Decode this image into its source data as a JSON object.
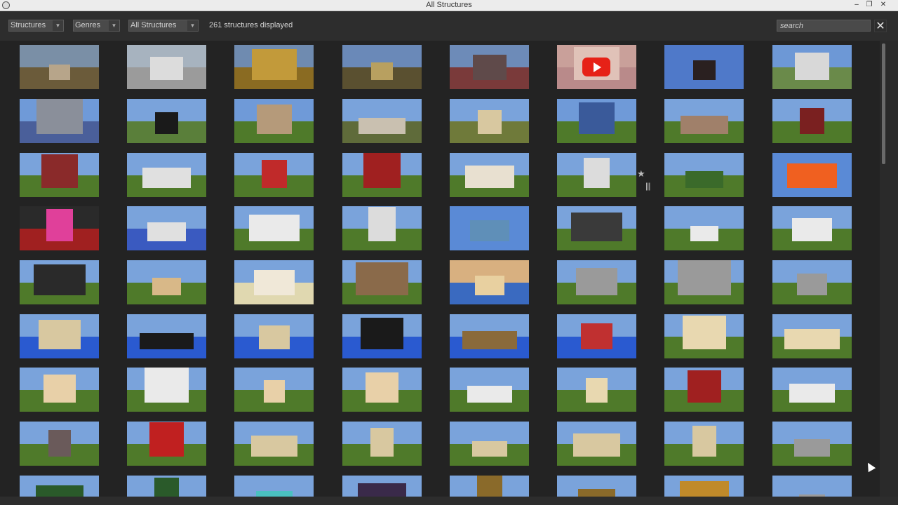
{
  "window": {
    "title": "All Structures"
  },
  "toolbar": {
    "filters": [
      {
        "label": "Structures"
      },
      {
        "label": "Genres"
      },
      {
        "label": "All Structures"
      }
    ],
    "count_text": "261 structures displayed",
    "search_placeholder": "search",
    "close_label": "✕"
  },
  "colors": {
    "accent": "#e62117",
    "background": "#232323",
    "toolbar": "#2d2d2d"
  },
  "icons": [
    "app-icon",
    "minimize-icon",
    "restore-icon",
    "close-icon",
    "chevron-down-icon",
    "youtube-play-icon",
    "star-icon",
    "drag-handle-icon",
    "mouse-cursor-icon"
  ],
  "grid": {
    "columns": 8,
    "thumbnails": [
      {
        "sky": "#7a8fa6",
        "ground": "#6b5b3a",
        "build": "#b7a58a"
      },
      {
        "sky": "#a7b3bf",
        "ground": "#9b9b9b",
        "build": "#dcdcdc"
      },
      {
        "sky": "#6f8bb0",
        "ground": "#8a6b22",
        "build": "#c29a3a"
      },
      {
        "sky": "#6a89b8",
        "ground": "#5a5030",
        "build": "#b8a060"
      },
      {
        "sky": "#6d8bb8",
        "ground": "#7a3a3a",
        "build": "#5f4a4a"
      },
      {
        "sky": "#c9a09a",
        "ground": "#b98a8a",
        "build": "#e0c2b8",
        "youtube": true
      },
      {
        "sky": "#4f79c9",
        "ground": "#4f79c9",
        "build": "#2a2020"
      },
      {
        "sky": "#6d98d6",
        "ground": "#6a8a4a",
        "build": "#d8d8d8"
      },
      {
        "sky": "#6f9ad8",
        "ground": "#4a5f9a",
        "build": "#8a8f9a"
      },
      {
        "sky": "#7aa3db",
        "ground": "#5a7f3a",
        "build": "#1a1a1a"
      },
      {
        "sky": "#6f9ad8",
        "ground": "#4f7a2a",
        "build": "#b59a7a"
      },
      {
        "sky": "#7aa3db",
        "ground": "#5f6b3a",
        "build": "#c9c0b0"
      },
      {
        "sky": "#7aa3db",
        "ground": "#6f7a3a",
        "build": "#d8c8a0"
      },
      {
        "sky": "#6f9ad8",
        "ground": "#4f7a2a",
        "build": "#3a5a9a"
      },
      {
        "sky": "#7aa3db",
        "ground": "#4f7a2a",
        "build": "#a0806a"
      },
      {
        "sky": "#7aa3db",
        "ground": "#4f7a2a",
        "build": "#7a2020"
      },
      {
        "sky": "#7aa3db",
        "ground": "#4f7a2a",
        "build": "#8a2a2a"
      },
      {
        "sky": "#7aa3db",
        "ground": "#4f7a2a",
        "build": "#e0e0e0"
      },
      {
        "sky": "#7aa3db",
        "ground": "#4f7a2a",
        "build": "#c02a2a"
      },
      {
        "sky": "#7aa3db",
        "ground": "#4f7a2a",
        "build": "#a02020"
      },
      {
        "sky": "#7aa3db",
        "ground": "#4f7a2a",
        "build": "#e8e0d0"
      },
      {
        "sky": "#7aa3db",
        "ground": "#4f7a2a",
        "build": "#dcdcdc"
      },
      {
        "sky": "#7aa3db",
        "ground": "#4f7a2a",
        "build": "#3a6a2a"
      },
      {
        "sky": "#5a8ad6",
        "ground": "#5a8ad6",
        "build": "#f06020"
      },
      {
        "sky": "#2a2a2a",
        "ground": "#a02020",
        "build": "#e0409a"
      },
      {
        "sky": "#7aa3db",
        "ground": "#3a5ac0",
        "build": "#e0e0e0"
      },
      {
        "sky": "#7aa3db",
        "ground": "#4f7a2a",
        "build": "#eaeaea"
      },
      {
        "sky": "#7aa3db",
        "ground": "#4f7a2a",
        "build": "#dcdcdc"
      },
      {
        "sky": "#5a8ad6",
        "ground": "#5a8ad6",
        "build": "#5f8fb8"
      },
      {
        "sky": "#7aa3db",
        "ground": "#4f7a2a",
        "build": "#3a3a3a"
      },
      {
        "sky": "#7aa3db",
        "ground": "#4f7a2a",
        "build": "#eaeaea"
      },
      {
        "sky": "#7aa3db",
        "ground": "#4f7a2a",
        "build": "#eaeaea"
      },
      {
        "sky": "#7aa3db",
        "ground": "#4f7a2a",
        "build": "#2a2a2a"
      },
      {
        "sky": "#7aa3db",
        "ground": "#4f7a2a",
        "build": "#d8b888"
      },
      {
        "sky": "#7aa3db",
        "ground": "#e0d8b0",
        "build": "#f0e8d8"
      },
      {
        "sky": "#7aa3db",
        "ground": "#4f7a2a",
        "build": "#8a6a4a"
      },
      {
        "sky": "#d8b080",
        "ground": "#3a6ac0",
        "build": "#e8d0a0"
      },
      {
        "sky": "#7aa3db",
        "ground": "#4f7a2a",
        "build": "#9a9a9a"
      },
      {
        "sky": "#7aa3db",
        "ground": "#4f7a2a",
        "build": "#9a9a9a"
      },
      {
        "sky": "#7aa3db",
        "ground": "#4f7a2a",
        "build": "#9a9a9a"
      },
      {
        "sky": "#7aa3db",
        "ground": "#2a5ad0",
        "build": "#d8c8a0"
      },
      {
        "sky": "#7aa3db",
        "ground": "#2a5ad0",
        "build": "#1a1a1a"
      },
      {
        "sky": "#7aa3db",
        "ground": "#2a5ad0",
        "build": "#d8c8a0"
      },
      {
        "sky": "#7aa3db",
        "ground": "#2a5ad0",
        "build": "#1a1a1a"
      },
      {
        "sky": "#7aa3db",
        "ground": "#2a5ad0",
        "build": "#8a6a3a"
      },
      {
        "sky": "#7aa3db",
        "ground": "#2a5ad0",
        "build": "#c03030"
      },
      {
        "sky": "#7aa3db",
        "ground": "#4f7a2a",
        "build": "#e8d8b0"
      },
      {
        "sky": "#7aa3db",
        "ground": "#4f7a2a",
        "build": "#e8d8b0"
      },
      {
        "sky": "#7aa3db",
        "ground": "#4f7a2a",
        "build": "#e8d0a8"
      },
      {
        "sky": "#7aa3db",
        "ground": "#4f7a2a",
        "build": "#eaeaea"
      },
      {
        "sky": "#7aa3db",
        "ground": "#4f7a2a",
        "build": "#e8d0a8"
      },
      {
        "sky": "#7aa3db",
        "ground": "#4f7a2a",
        "build": "#e8d0a8"
      },
      {
        "sky": "#7aa3db",
        "ground": "#4f7a2a",
        "build": "#eaeaea"
      },
      {
        "sky": "#7aa3db",
        "ground": "#4f7a2a",
        "build": "#e8d8b0"
      },
      {
        "sky": "#7aa3db",
        "ground": "#4f7a2a",
        "build": "#a02020"
      },
      {
        "sky": "#7aa3db",
        "ground": "#4f7a2a",
        "build": "#eaeaea"
      },
      {
        "sky": "#7aa3db",
        "ground": "#4f7a2a",
        "build": "#6a5a5a"
      },
      {
        "sky": "#7aa3db",
        "ground": "#4f7a2a",
        "build": "#c02020"
      },
      {
        "sky": "#7aa3db",
        "ground": "#4f7a2a",
        "build": "#d8c8a0"
      },
      {
        "sky": "#7aa3db",
        "ground": "#4f7a2a",
        "build": "#d8c8a0"
      },
      {
        "sky": "#7aa3db",
        "ground": "#4f7a2a",
        "build": "#d8c8a0"
      },
      {
        "sky": "#7aa3db",
        "ground": "#4f7a2a",
        "build": "#d8c8a0"
      },
      {
        "sky": "#7aa3db",
        "ground": "#4f7a2a",
        "build": "#d8c8a0"
      },
      {
        "sky": "#7aa3db",
        "ground": "#4f7a2a",
        "build": "#9a9a9a"
      },
      {
        "sky": "#7aa3db",
        "ground": "#4f7a2a",
        "build": "#2a5a2a"
      },
      {
        "sky": "#7aa3db",
        "ground": "#4f7a2a",
        "build": "#2a5a2a"
      },
      {
        "sky": "#7aa3db",
        "ground": "#4f7a2a",
        "build": "#4ac0c0"
      },
      {
        "sky": "#7aa3db",
        "ground": "#4f7a2a",
        "build": "#3a2a4a"
      },
      {
        "sky": "#7aa3db",
        "ground": "#4f7a2a",
        "build": "#8a6a2a"
      },
      {
        "sky": "#7aa3db",
        "ground": "#4f7a2a",
        "build": "#8a6a2a"
      },
      {
        "sky": "#7aa3db",
        "ground": "#4f7a2a",
        "build": "#c08a2a"
      },
      {
        "sky": "#7aa3db",
        "ground": "#4f7a2a",
        "build": "#9a9a9a"
      }
    ]
  }
}
